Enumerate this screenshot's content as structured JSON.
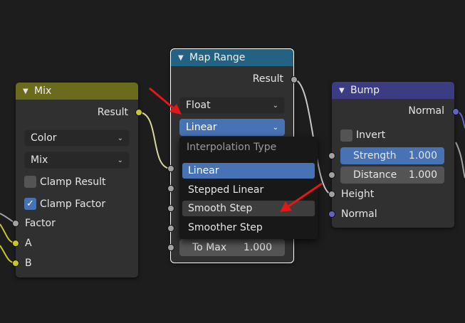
{
  "colors": {
    "background": "#1d1d1d",
    "node_body": "#303030",
    "mix_header": "#6b6b1e",
    "map_range_header": "#246283",
    "bump_header": "#3c3c83",
    "accent_blue": "#4772b3",
    "annotation_red": "#e01818"
  },
  "mix_node": {
    "title": "Mix",
    "result_label": "Result",
    "data_type": "Color",
    "blend_mode": "Mix",
    "clamp_result": {
      "label": "Clamp Result",
      "checked": false
    },
    "clamp_factor": {
      "label": "Clamp Factor",
      "checked": true
    },
    "inputs": [
      "Factor",
      "A",
      "B"
    ]
  },
  "map_range_node": {
    "title": "Map Range",
    "result_label": "Result",
    "data_type": "Float",
    "interpolation": "Linear",
    "to_max": {
      "label": "To Max",
      "value": "1.000"
    }
  },
  "interpolation_menu": {
    "title": "Interpolation Type",
    "items": [
      "Linear",
      "Stepped Linear",
      "Smooth Step",
      "Smoother Step"
    ],
    "active_index": 0,
    "hover_index": 2
  },
  "bump_node": {
    "title": "Bump",
    "normal_out_label": "Normal",
    "invert": {
      "label": "Invert",
      "checked": false
    },
    "strength": {
      "label": "Strength",
      "value": "1.000"
    },
    "distance": {
      "label": "Distance",
      "value": "1.000"
    },
    "height_label": "Height",
    "normal_in_label": "Normal"
  },
  "icons": {
    "chevron": "chevron-down-icon",
    "dropdown_arrow": "dropdown-arrow-icon",
    "check": "checkmark-icon",
    "pointer": "red-arrow-annotation"
  }
}
